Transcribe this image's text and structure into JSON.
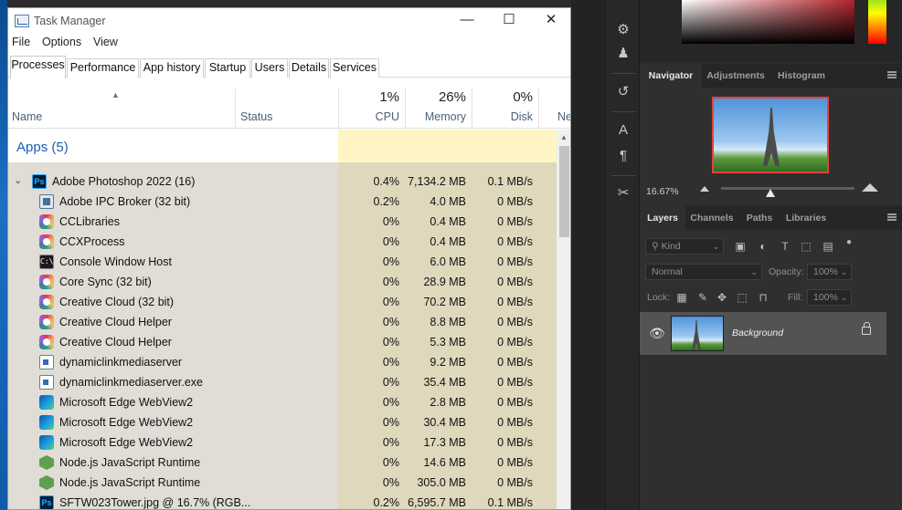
{
  "task_manager": {
    "title": "Task Manager",
    "window_controls": {
      "minimize": "—",
      "maximize": "☐",
      "close": "✕"
    },
    "menu": [
      "File",
      "Options",
      "View"
    ],
    "tabs": [
      "Processes",
      "Performance",
      "App history",
      "Startup",
      "Users",
      "Details",
      "Services"
    ],
    "active_tab": "Processes",
    "columns": {
      "name": "Name",
      "status": "Status",
      "cpu": {
        "percent": "1%",
        "label": "CPU"
      },
      "memory": {
        "percent": "26%",
        "label": "Memory"
      },
      "disk": {
        "percent": "0%",
        "label": "Disk"
      },
      "network": {
        "label": "Ne"
      }
    },
    "group": "Apps (5)",
    "rows": [
      {
        "name": "Adobe Photoshop 2022 (16)",
        "icon": "photoshop-icon",
        "cpu": "0.4%",
        "memory": "7,134.2 MB",
        "disk": "0.1 MB/s"
      },
      {
        "name": "Adobe IPC Broker (32 bit)",
        "icon": "ipc-broker-icon",
        "cpu": "0.2%",
        "memory": "4.0 MB",
        "disk": "0 MB/s"
      },
      {
        "name": "CCLibraries",
        "icon": "creative-cloud-icon",
        "cpu": "0%",
        "memory": "0.4 MB",
        "disk": "0 MB/s"
      },
      {
        "name": "CCXProcess",
        "icon": "creative-cloud-icon",
        "cpu": "0%",
        "memory": "0.4 MB",
        "disk": "0 MB/s"
      },
      {
        "name": "Console Window Host",
        "icon": "console-icon",
        "cpu": "0%",
        "memory": "6.0 MB",
        "disk": "0 MB/s"
      },
      {
        "name": "Core Sync (32 bit)",
        "icon": "creative-cloud-icon",
        "cpu": "0%",
        "memory": "28.9 MB",
        "disk": "0 MB/s"
      },
      {
        "name": "Creative Cloud (32 bit)",
        "icon": "creative-cloud-icon",
        "cpu": "0%",
        "memory": "70.2 MB",
        "disk": "0 MB/s"
      },
      {
        "name": "Creative Cloud Helper",
        "icon": "creative-cloud-icon",
        "cpu": "0%",
        "memory": "8.8 MB",
        "disk": "0 MB/s"
      },
      {
        "name": "Creative Cloud Helper",
        "icon": "creative-cloud-icon",
        "cpu": "0%",
        "memory": "5.3 MB",
        "disk": "0 MB/s"
      },
      {
        "name": "dynamiclinkmediaserver",
        "icon": "window-icon",
        "cpu": "0%",
        "memory": "9.2 MB",
        "disk": "0 MB/s"
      },
      {
        "name": "dynamiclinkmediaserver.exe",
        "icon": "window-icon",
        "cpu": "0%",
        "memory": "35.4 MB",
        "disk": "0 MB/s"
      },
      {
        "name": "Microsoft Edge WebView2",
        "icon": "edge-icon",
        "cpu": "0%",
        "memory": "2.8 MB",
        "disk": "0 MB/s"
      },
      {
        "name": "Microsoft Edge WebView2",
        "icon": "edge-icon",
        "cpu": "0%",
        "memory": "30.4 MB",
        "disk": "0 MB/s"
      },
      {
        "name": "Microsoft Edge WebView2",
        "icon": "edge-icon",
        "cpu": "0%",
        "memory": "17.3 MB",
        "disk": "0 MB/s"
      },
      {
        "name": "Node.js JavaScript Runtime",
        "icon": "nodejs-icon",
        "cpu": "0%",
        "memory": "14.6 MB",
        "disk": "0 MB/s"
      },
      {
        "name": "Node.js JavaScript Runtime",
        "icon": "nodejs-icon",
        "cpu": "0%",
        "memory": "305.0 MB",
        "disk": "0 MB/s"
      },
      {
        "name": "SFTW023Tower.jpg @ 16.7% (RGB...",
        "icon": "photoshop-icon",
        "cpu": "0.2%",
        "memory": "6,595.7 MB",
        "disk": "0.1 MB/s"
      }
    ]
  },
  "photoshop": {
    "panel_tabs_top": [
      "Navigator",
      "Adjustments",
      "Histogram"
    ],
    "navigator": {
      "zoom": "16.67%"
    },
    "panel_tabs_layers": [
      "Layers",
      "Channels",
      "Paths",
      "Libraries"
    ],
    "layers": {
      "filter_kind": "Kind",
      "blend_mode": "Normal",
      "opacity_label": "Opacity:",
      "opacity_value": "100%",
      "lock_label": "Lock:",
      "fill_label": "Fill:",
      "fill_value": "100%",
      "layer_name": "Background"
    },
    "colors": {
      "accent_red": "#e8413c",
      "panel_bg": "#2f2f2f",
      "selected_layer": "#535353"
    }
  }
}
